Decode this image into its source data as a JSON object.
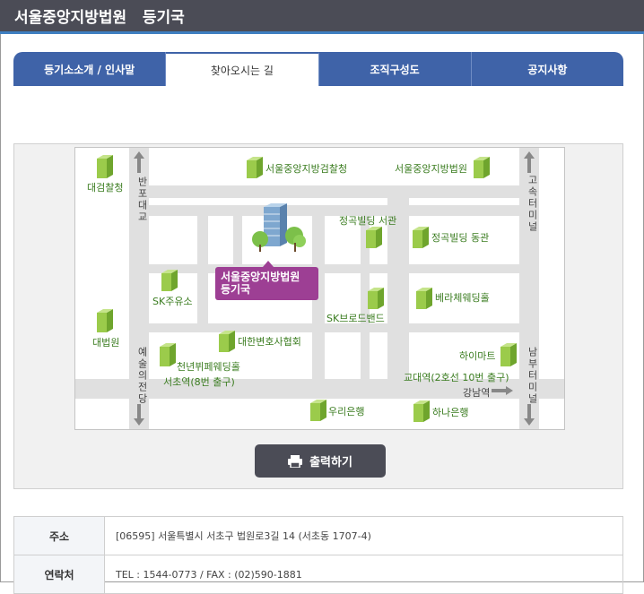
{
  "title": "서울중앙지방법원   등기국",
  "tabs": [
    {
      "label": "등기소소개 / 인사말"
    },
    {
      "label": "찾아오시는 길"
    },
    {
      "label": "조직구성도"
    },
    {
      "label": "공지사항"
    }
  ],
  "map": {
    "court_label_line1": "서울중앙지방법원",
    "court_label_line2": "등기국",
    "places": {
      "daegeom": "대검찰청",
      "prosecutor": "서울중앙지방검찰청",
      "court_main": "서울중앙지방법원",
      "jeonggok_west": "정곡빌딩 서관",
      "jeonggok_east": "정곡빌딩 동관",
      "sk_gas": "SK주유소",
      "daebeobwon": "대법원",
      "sk_broadband": "SK브로드밴드",
      "verachae": "베라체웨딩홀",
      "bar_assoc": "대한변호사협회",
      "himart": "하이마트",
      "millennium": "천년뷔페웨딩홀",
      "seocho_exit": "서초역(8번 출구)",
      "gyodae_exit": "교대역(2호선 10번 출구)",
      "gangnam": "강남역",
      "woori": "우리은행",
      "hana": "하나은행"
    },
    "roads": {
      "banpo": "반포대교",
      "gosok": "고속터미널",
      "arts": "예술의전당",
      "nambu": "남부터미널"
    }
  },
  "print_label": "출력하기",
  "info": [
    {
      "key": "주소",
      "value": "[06595] 서울특별시 서초구 법원로3길 14 (서초동 1707-4)"
    },
    {
      "key": "연락처",
      "value": "TEL : 1544-0773 / FAX : (02)590-1881"
    }
  ]
}
